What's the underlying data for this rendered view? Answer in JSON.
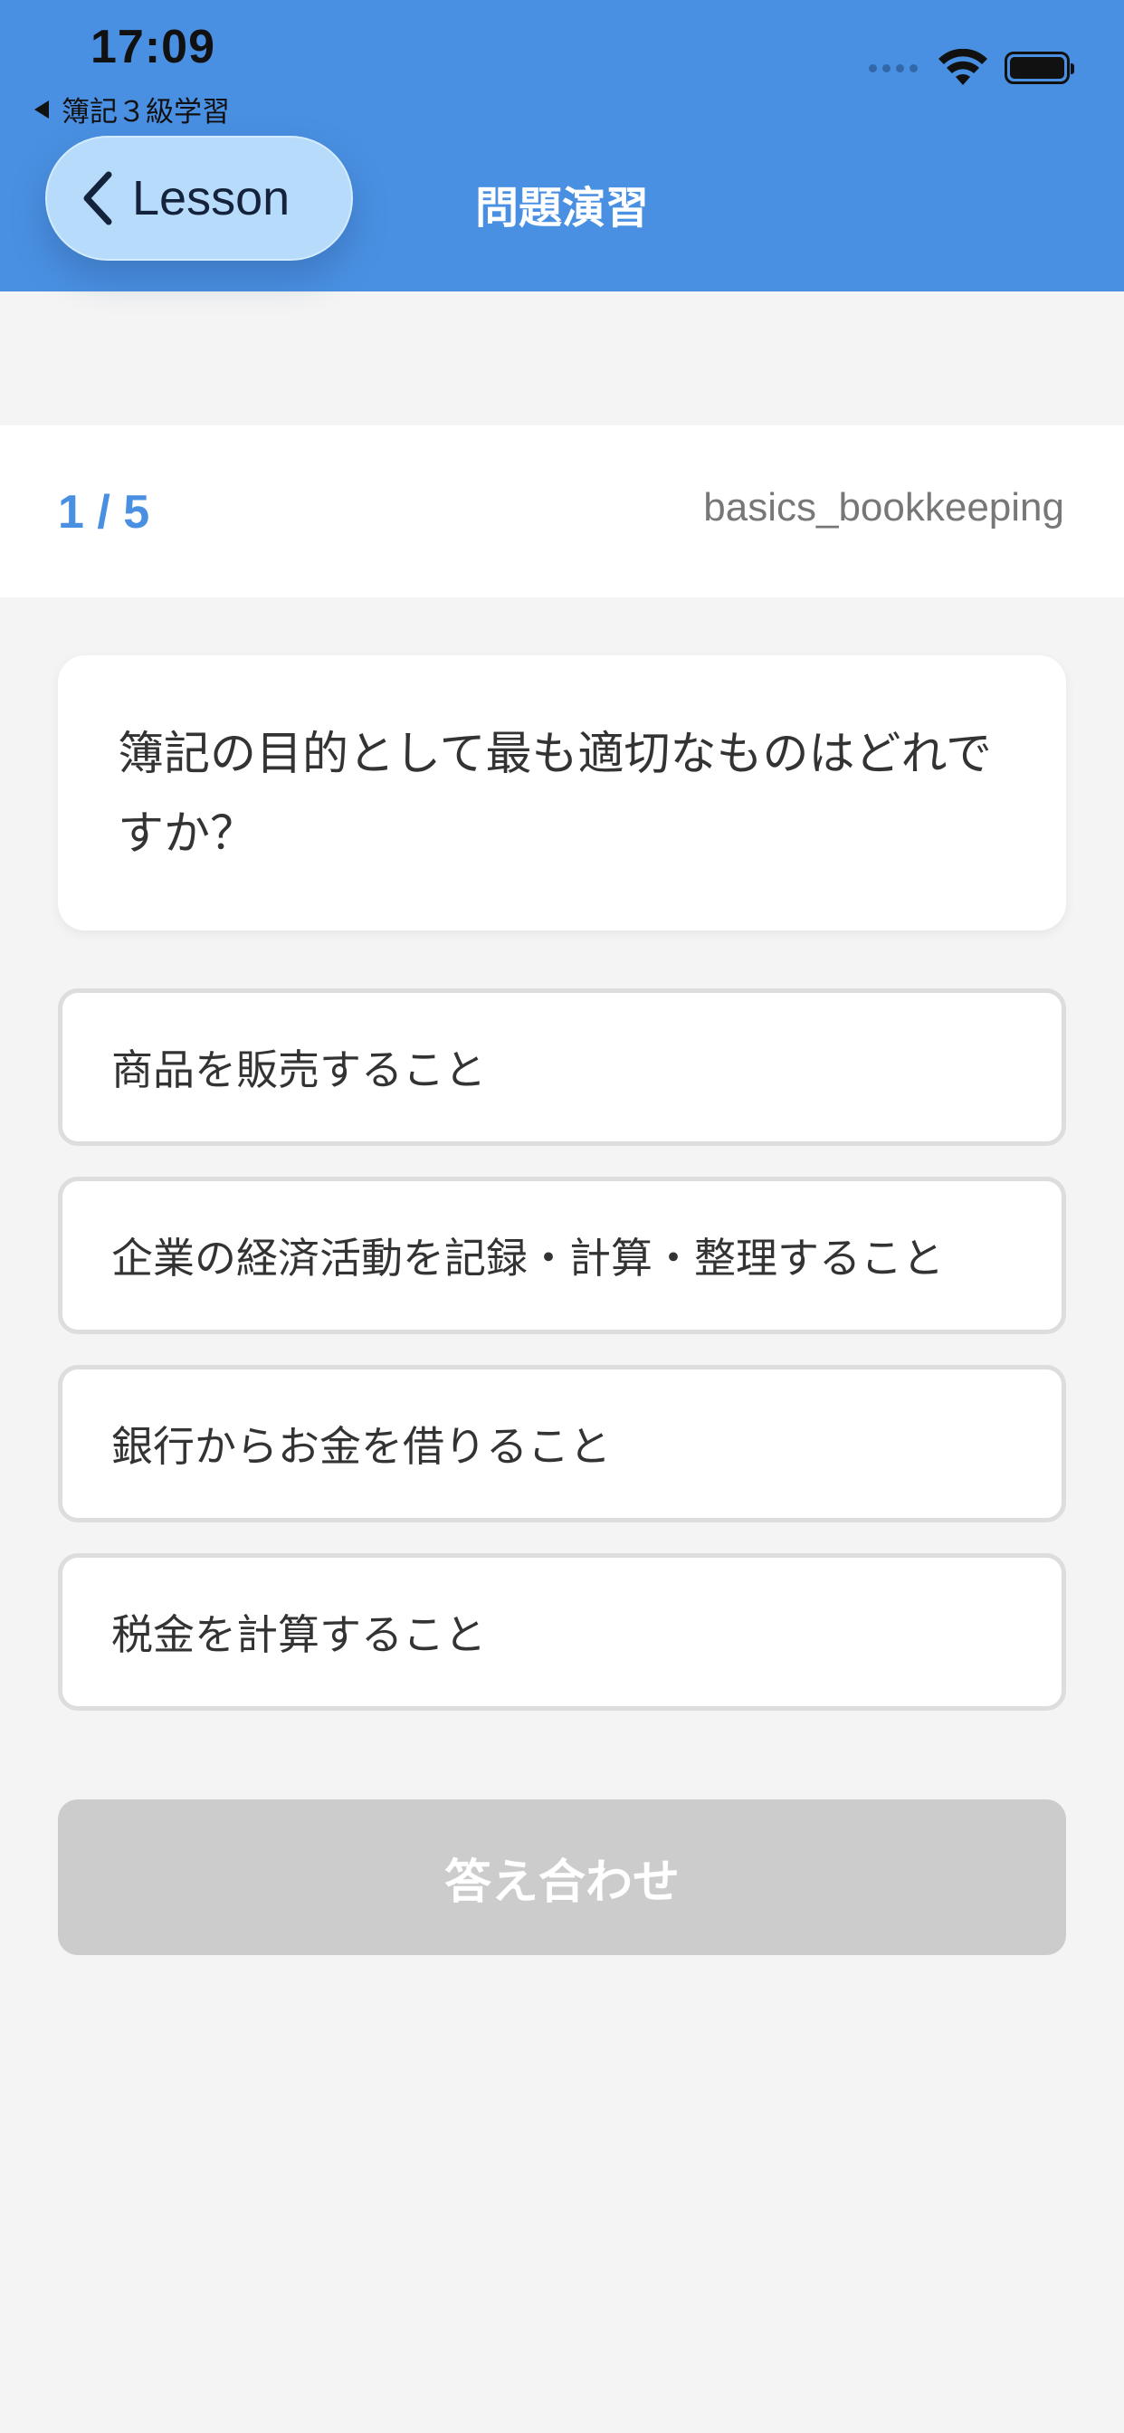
{
  "status_bar": {
    "time": "17:09",
    "back_app_label": "簿記３級学習"
  },
  "nav": {
    "back_label": "Lesson",
    "title": "問題演習"
  },
  "progress": {
    "count": "1 / 5",
    "category": "basics_bookkeeping"
  },
  "question": {
    "text": "簿記の目的として最も適切なものはどれですか？"
  },
  "options": [
    {
      "label": "商品を販売すること"
    },
    {
      "label": "企業の経済活動を記録・計算・整理すること"
    },
    {
      "label": "銀行からお金を借りること"
    },
    {
      "label": "税金を計算すること"
    }
  ],
  "actions": {
    "check_label": "答え合わせ"
  },
  "colors": {
    "header": "#4a90e2",
    "accent": "#4a90e2",
    "back_button": "#b7dcfb",
    "background": "#f4f4f4",
    "disabled_button": "#cccccc"
  }
}
